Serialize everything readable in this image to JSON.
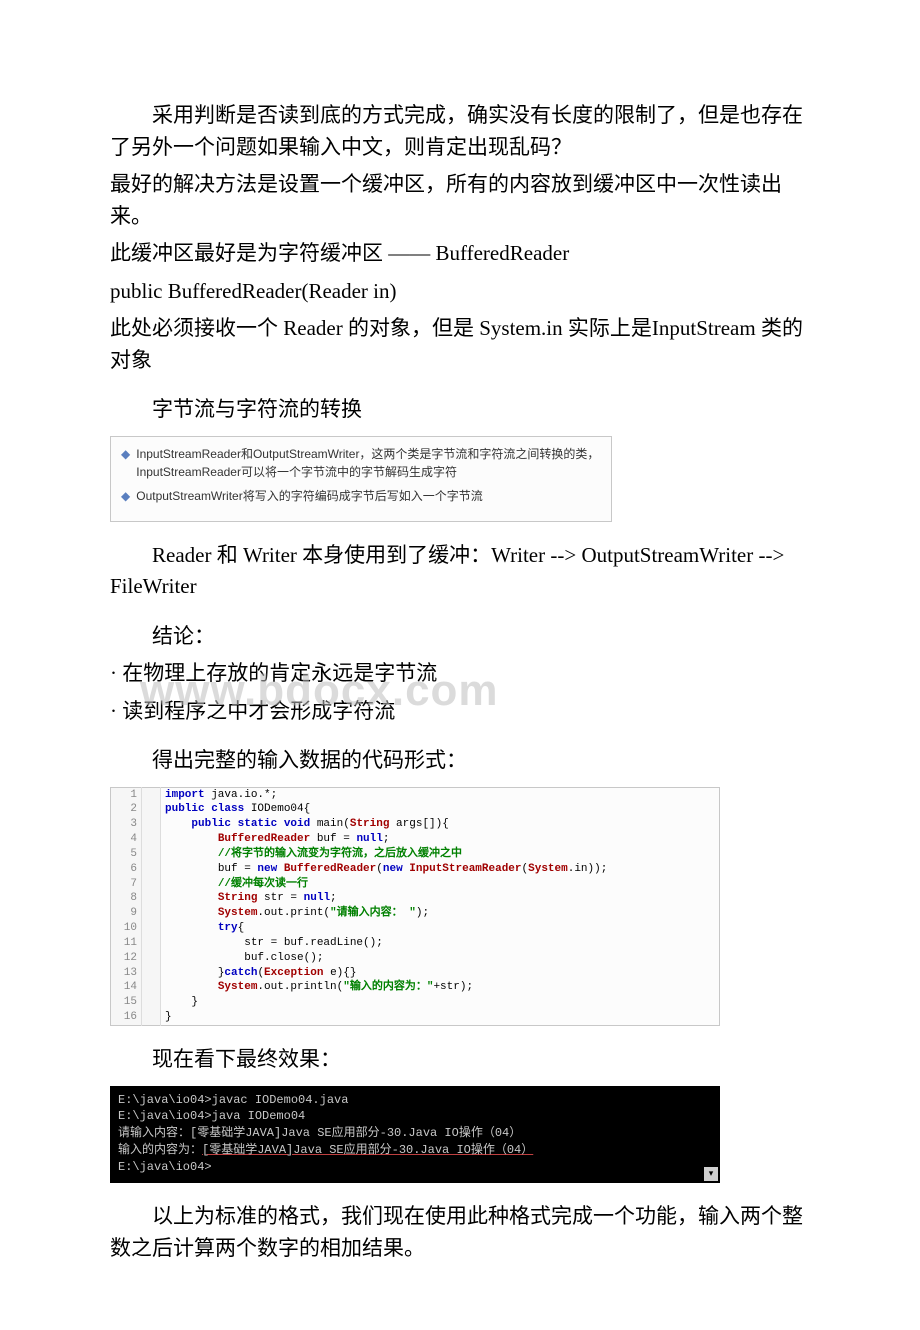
{
  "p1": "采用判断是否读到底的方式完成，确实没有长度的限制了，但是也存在了另外一个问题如果输入中文，则肯定出现乱码？",
  "p2": "最好的解决方法是设置一个缓冲区，所有的内容放到缓冲区中一次性读出来。",
  "p3": "此缓冲区最好是为字符缓冲区 —— BufferedReader",
  "p4": "public BufferedReader(Reader in)",
  "p5": "此处必须接收一个 Reader 的对象，但是 System.in 实际上是InputStream 类的对象",
  "h1": "字节流与字符流的转换",
  "bullets": {
    "b1": "InputStreamReader和OutputStreamWriter，这两个类是字节流和字符流之间转换的类，InputStreamReader可以将一个字节流中的字节解码生成字符",
    "b2": "OutputStreamWriter将写入的字符编码成字节后写如入一个字节流"
  },
  "p6": "Reader 和 Writer 本身使用到了缓冲：Writer --> OutputStreamWriter --> FileWriter",
  "h2": "结论：",
  "p7": "· 在物理上存放的肯定永远是字节流",
  "p8": "· 读到程序之中才会形成字符流",
  "h3": "得出完整的输入数据的代码形式：",
  "code": {
    "l1_a": "import",
    "l1_b": " java.io.*;",
    "l2_a": "public class",
    "l2_b": " IODemo04{",
    "l3_a": "public static void",
    "l3_b": " main(",
    "l3_c": "String",
    "l3_d": " args[]){",
    "l4_a": "BufferedReader",
    "l4_b": " buf = ",
    "l4_c": "null",
    "l4_d": ";",
    "l5": "//将字节的输入流变为字符流，之后放入缓冲之中",
    "l6_a": "buf = ",
    "l6_b": "new",
    "l6_c": " BufferedReader",
    "l6_d": "(",
    "l6_e": "new",
    "l6_f": " InputStreamReader",
    "l6_g": "(",
    "l6_h": "System",
    "l6_i": ".in));",
    "l7": "//缓冲每次读一行",
    "l8_a": "String",
    "l8_b": " str = ",
    "l8_c": "null",
    "l8_d": ";",
    "l9_a": "System",
    "l9_b": ".out.print(",
    "l9_c": "\"请输入内容： \"",
    "l9_d": ");",
    "l10_a": "try",
    "l10_b": "{",
    "l11": "str = buf.readLine();",
    "l12": "buf.close();",
    "l13_a": "}",
    "l13_b": "catch",
    "l13_c": "(",
    "l13_d": "Exception",
    "l13_e": " e){}",
    "l14_a": "System",
    "l14_b": ".out.println(",
    "l14_c": "\"输入的内容为：\"",
    "l14_d": "+str);",
    "l15": "}",
    "l16": "}",
    "ln1": "1",
    "ln2": "2",
    "ln3": "3",
    "ln4": "4",
    "ln5": "5",
    "ln6": "6",
    "ln7": "7",
    "ln8": "8",
    "ln9": "9",
    "ln10": "10",
    "ln11": "11",
    "ln12": "12",
    "ln13": "13",
    "ln14": "14",
    "ln15": "15",
    "ln16": "16"
  },
  "h4": "现在看下最终效果：",
  "term": {
    "t1": "E:\\java\\io04>javac IODemo04.java",
    "t2": "",
    "t3": "E:\\java\\io04>java IODemo04",
    "t4": "请输入内容：[零基础学JAVA]Java SE应用部分-30.Java IO操作（04）",
    "t5a": "输入的内容为：",
    "t5b": "[零基础学JAVA]Java SE应用部分-30.Java IO操作（04）",
    "t6": "",
    "t7": "E:\\java\\io04>",
    "scroll": "▾"
  },
  "p9": "以上为标准的格式，我们现在使用此种格式完成一个功能，输入两个整数之后计算两个数字的相加结果。",
  "watermark": "www.bdocx.com"
}
